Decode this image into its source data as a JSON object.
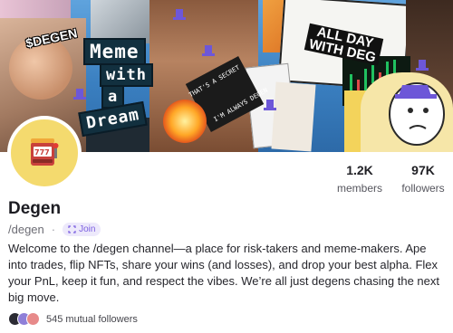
{
  "banner": {
    "tag_text": "$DEGEN",
    "meme_words": [
      "Meme",
      "with",
      "a",
      "Dream"
    ],
    "allday_text": "ALL DAY\nWITH DEG",
    "lighter_text_1": "THAT'S A SECRET",
    "lighter_text_2": "I'M ALWAYS DEGEN"
  },
  "avatar": {
    "icon": "slot-machine-icon"
  },
  "stats": {
    "members_value": "1.2K",
    "members_label": "members",
    "followers_value": "97K",
    "followers_label": "followers"
  },
  "channel": {
    "name": "Degen",
    "handle": "/degen",
    "separator": "·",
    "join_label": "Join",
    "join_icon": "join-icon",
    "description": "Welcome to the /degen channel—a place for risk-takers and meme-makers. Ape into trades, flip NFTs, share your wins (and losses), and drop your best alpha. Flex your PnL, keep it fun, and respect the vibes. We’re all just degens chasing the next big move."
  },
  "mutual": {
    "text": "545 mutual followers",
    "avatar_colors": [
      "#2b2b33",
      "#8f7fd8",
      "#e78a8a"
    ]
  },
  "colors": {
    "accent": "#7a5ee0",
    "join_bg": "#ede9fb",
    "avatar_bg": "#f4da6e"
  }
}
